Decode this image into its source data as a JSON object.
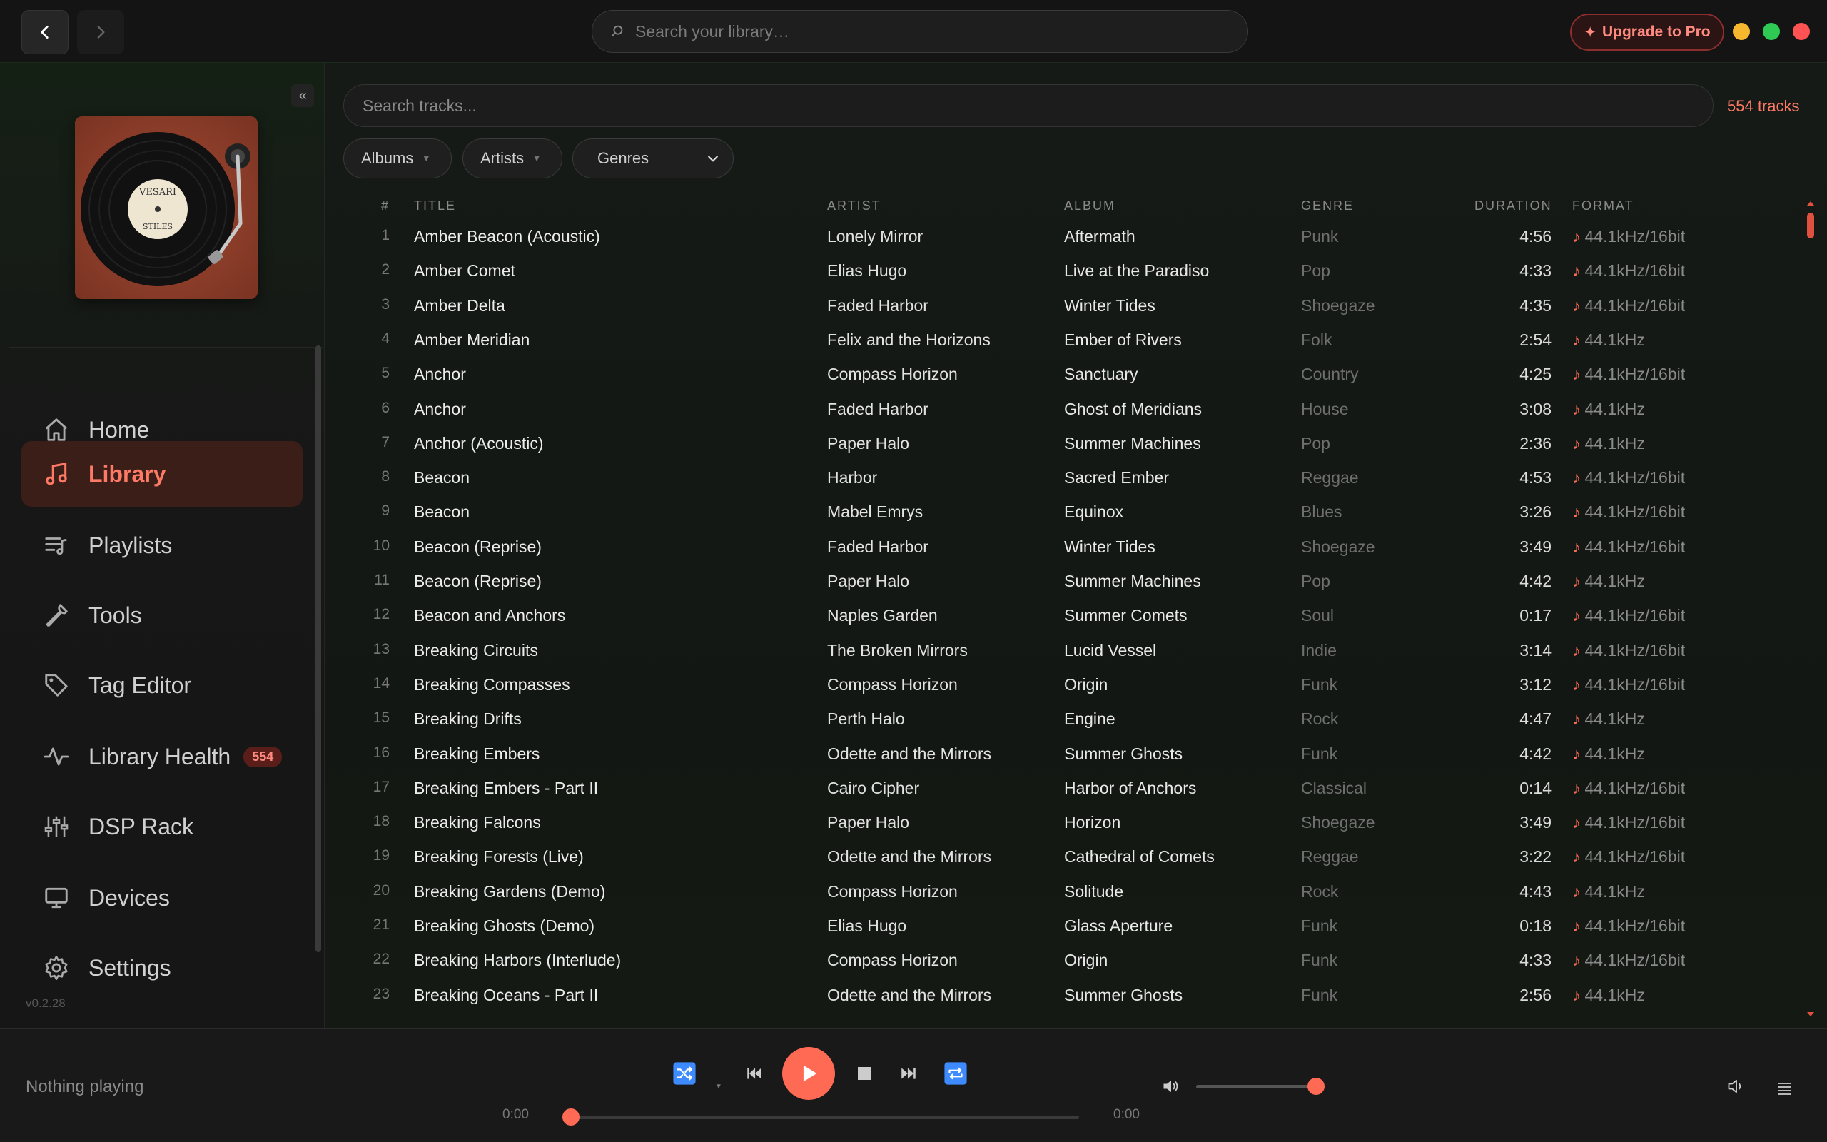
{
  "topbar": {
    "search_placeholder": "Search your library…",
    "upgrade_label": "Upgrade to Pro",
    "window_colors": {
      "minimize": "#f5b82e",
      "maximize": "#2fca53",
      "close": "#ff5252"
    }
  },
  "sidebar": {
    "album_art_label_top": "VESARI",
    "album_art_label_bottom": "STILES",
    "items": [
      {
        "label": "Home",
        "icon": "home-icon"
      },
      {
        "label": "Library",
        "icon": "music-note-icon",
        "active": true
      },
      {
        "label": "Playlists",
        "icon": "playlist-icon"
      },
      {
        "label": "Tools",
        "icon": "wrench-icon"
      },
      {
        "label": "Tag Editor",
        "icon": "tag-icon"
      },
      {
        "label": "Library Health",
        "icon": "pulse-icon",
        "badge": "554"
      },
      {
        "label": "DSP Rack",
        "icon": "sliders-icon"
      },
      {
        "label": "Devices",
        "icon": "monitor-icon"
      },
      {
        "label": "Settings",
        "icon": "gear-icon"
      }
    ],
    "version": "v0.2.28",
    "collapse_label": "«"
  },
  "main": {
    "search_placeholder": "Search tracks...",
    "track_count": "554 tracks",
    "filters": {
      "albums": "Albums",
      "artists": "Artists",
      "genres": "Genres"
    },
    "columns": {
      "num": "#",
      "title": "TITLE",
      "artist": "ARTIST",
      "album": "ALBUM",
      "genre": "GENRE",
      "duration": "DURATION",
      "format": "FORMAT"
    },
    "tracks": [
      {
        "num": "1",
        "title": "Amber Beacon (Acoustic)",
        "artist": "Lonely Mirror",
        "album": "Aftermath",
        "genre": "Punk",
        "duration": "4:56",
        "format": "44.1kHz/16bit"
      },
      {
        "num": "2",
        "title": "Amber Comet",
        "artist": "Elias Hugo",
        "album": "Live at the Paradiso",
        "genre": "Pop",
        "duration": "4:33",
        "format": "44.1kHz/16bit"
      },
      {
        "num": "3",
        "title": "Amber Delta",
        "artist": "Faded Harbor",
        "album": "Winter Tides",
        "genre": "Shoegaze",
        "duration": "4:35",
        "format": "44.1kHz/16bit"
      },
      {
        "num": "4",
        "title": "Amber Meridian",
        "artist": "Felix and the Horizons",
        "album": "Ember of Rivers",
        "genre": "Folk",
        "duration": "2:54",
        "format": "44.1kHz"
      },
      {
        "num": "5",
        "title": "Anchor",
        "artist": "Compass Horizon",
        "album": "Sanctuary",
        "genre": "Country",
        "duration": "4:25",
        "format": "44.1kHz/16bit"
      },
      {
        "num": "6",
        "title": "Anchor",
        "artist": "Faded Harbor",
        "album": "Ghost of Meridians",
        "genre": "House",
        "duration": "3:08",
        "format": "44.1kHz"
      },
      {
        "num": "7",
        "title": "Anchor (Acoustic)",
        "artist": "Paper Halo",
        "album": "Summer Machines",
        "genre": "Pop",
        "duration": "2:36",
        "format": "44.1kHz"
      },
      {
        "num": "8",
        "title": "Beacon",
        "artist": "Harbor",
        "album": "Sacred Ember",
        "genre": "Reggae",
        "duration": "4:53",
        "format": "44.1kHz/16bit"
      },
      {
        "num": "9",
        "title": "Beacon",
        "artist": "Mabel Emrys",
        "album": "Equinox",
        "genre": "Blues",
        "duration": "3:26",
        "format": "44.1kHz/16bit"
      },
      {
        "num": "10",
        "title": "Beacon (Reprise)",
        "artist": "Faded Harbor",
        "album": "Winter Tides",
        "genre": "Shoegaze",
        "duration": "3:49",
        "format": "44.1kHz/16bit"
      },
      {
        "num": "11",
        "title": "Beacon (Reprise)",
        "artist": "Paper Halo",
        "album": "Summer Machines",
        "genre": "Pop",
        "duration": "4:42",
        "format": "44.1kHz"
      },
      {
        "num": "12",
        "title": "Beacon and Anchors",
        "artist": "Naples Garden",
        "album": "Summer Comets",
        "genre": "Soul",
        "duration": "0:17",
        "format": "44.1kHz/16bit"
      },
      {
        "num": "13",
        "title": "Breaking Circuits",
        "artist": "The Broken Mirrors",
        "album": "Lucid Vessel",
        "genre": "Indie",
        "duration": "3:14",
        "format": "44.1kHz/16bit"
      },
      {
        "num": "14",
        "title": "Breaking Compasses",
        "artist": "Compass Horizon",
        "album": "Origin",
        "genre": "Funk",
        "duration": "3:12",
        "format": "44.1kHz/16bit"
      },
      {
        "num": "15",
        "title": "Breaking Drifts",
        "artist": "Perth Halo",
        "album": "Engine",
        "genre": "Rock",
        "duration": "4:47",
        "format": "44.1kHz"
      },
      {
        "num": "16",
        "title": "Breaking Embers",
        "artist": "Odette and the Mirrors",
        "album": "Summer Ghosts",
        "genre": "Funk",
        "duration": "4:42",
        "format": "44.1kHz"
      },
      {
        "num": "17",
        "title": "Breaking Embers - Part II",
        "artist": "Cairo Cipher",
        "album": "Harbor of Anchors",
        "genre": "Classical",
        "duration": "0:14",
        "format": "44.1kHz/16bit"
      },
      {
        "num": "18",
        "title": "Breaking Falcons",
        "artist": "Paper Halo",
        "album": "Horizon",
        "genre": "Shoegaze",
        "duration": "3:49",
        "format": "44.1kHz/16bit"
      },
      {
        "num": "19",
        "title": "Breaking Forests (Live)",
        "artist": "Odette and the Mirrors",
        "album": "Cathedral of Comets",
        "genre": "Reggae",
        "duration": "3:22",
        "format": "44.1kHz/16bit"
      },
      {
        "num": "20",
        "title": "Breaking Gardens (Demo)",
        "artist": "Compass Horizon",
        "album": "Solitude",
        "genre": "Rock",
        "duration": "4:43",
        "format": "44.1kHz"
      },
      {
        "num": "21",
        "title": "Breaking Ghosts (Demo)",
        "artist": "Elias Hugo",
        "album": "Glass Aperture",
        "genre": "Funk",
        "duration": "0:18",
        "format": "44.1kHz/16bit"
      },
      {
        "num": "22",
        "title": "Breaking Harbors (Interlude)",
        "artist": "Compass Horizon",
        "album": "Origin",
        "genre": "Funk",
        "duration": "4:33",
        "format": "44.1kHz/16bit"
      },
      {
        "num": "23",
        "title": "Breaking Oceans - Part II",
        "artist": "Odette and the Mirrors",
        "album": "Summer Ghosts",
        "genre": "Funk",
        "duration": "2:56",
        "format": "44.1kHz"
      }
    ]
  },
  "player": {
    "now_playing": "Nothing playing",
    "elapsed": "0:00",
    "total": "0:00",
    "progress": 0,
    "volume": 1.0,
    "accent": "#ff6a55",
    "shuffle_color": "#3d8bff"
  }
}
